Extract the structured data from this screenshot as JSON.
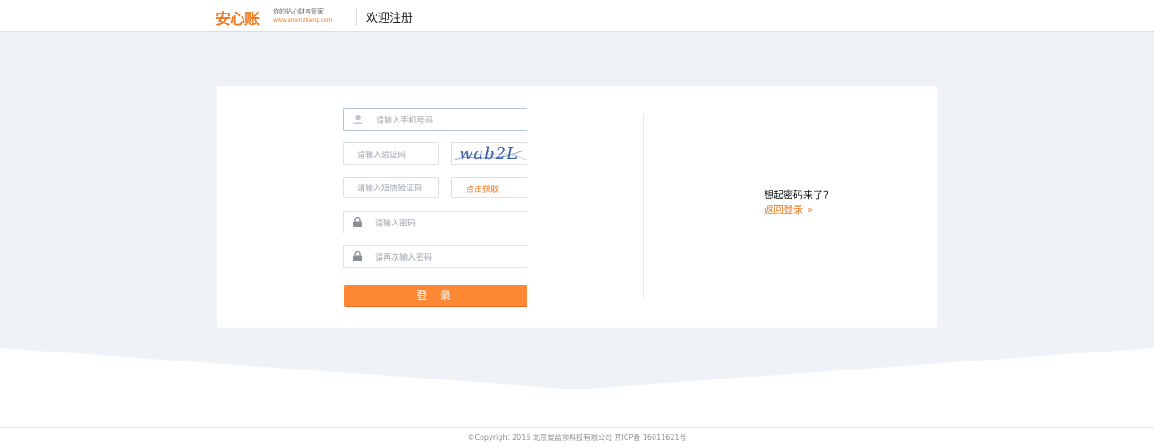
{
  "header": {
    "brand": "安心账",
    "tagline": "你的贴心财务管家",
    "url": "www.anxinzhang.com",
    "title": "欢迎注册"
  },
  "form": {
    "phone_placeholder": "请输入手机号码",
    "captcha_placeholder": "请输入验证码",
    "captcha_text": "wab2L",
    "sms_placeholder": "请输入短信验证码",
    "sms_button": "点击获取",
    "password_placeholder": "请输入密码",
    "password_confirm_placeholder": "请再次输入密码",
    "submit_label": "登 录"
  },
  "side": {
    "question": "想起密码来了？",
    "link": "返回登录"
  },
  "footer": {
    "copyright": "©Copyright 2016 北京爱蓝领科技有限公司 京ICP备 16011621号"
  },
  "colors": {
    "brand": "#f07a21",
    "button": "#fe8833",
    "band": "#eff2f6"
  }
}
